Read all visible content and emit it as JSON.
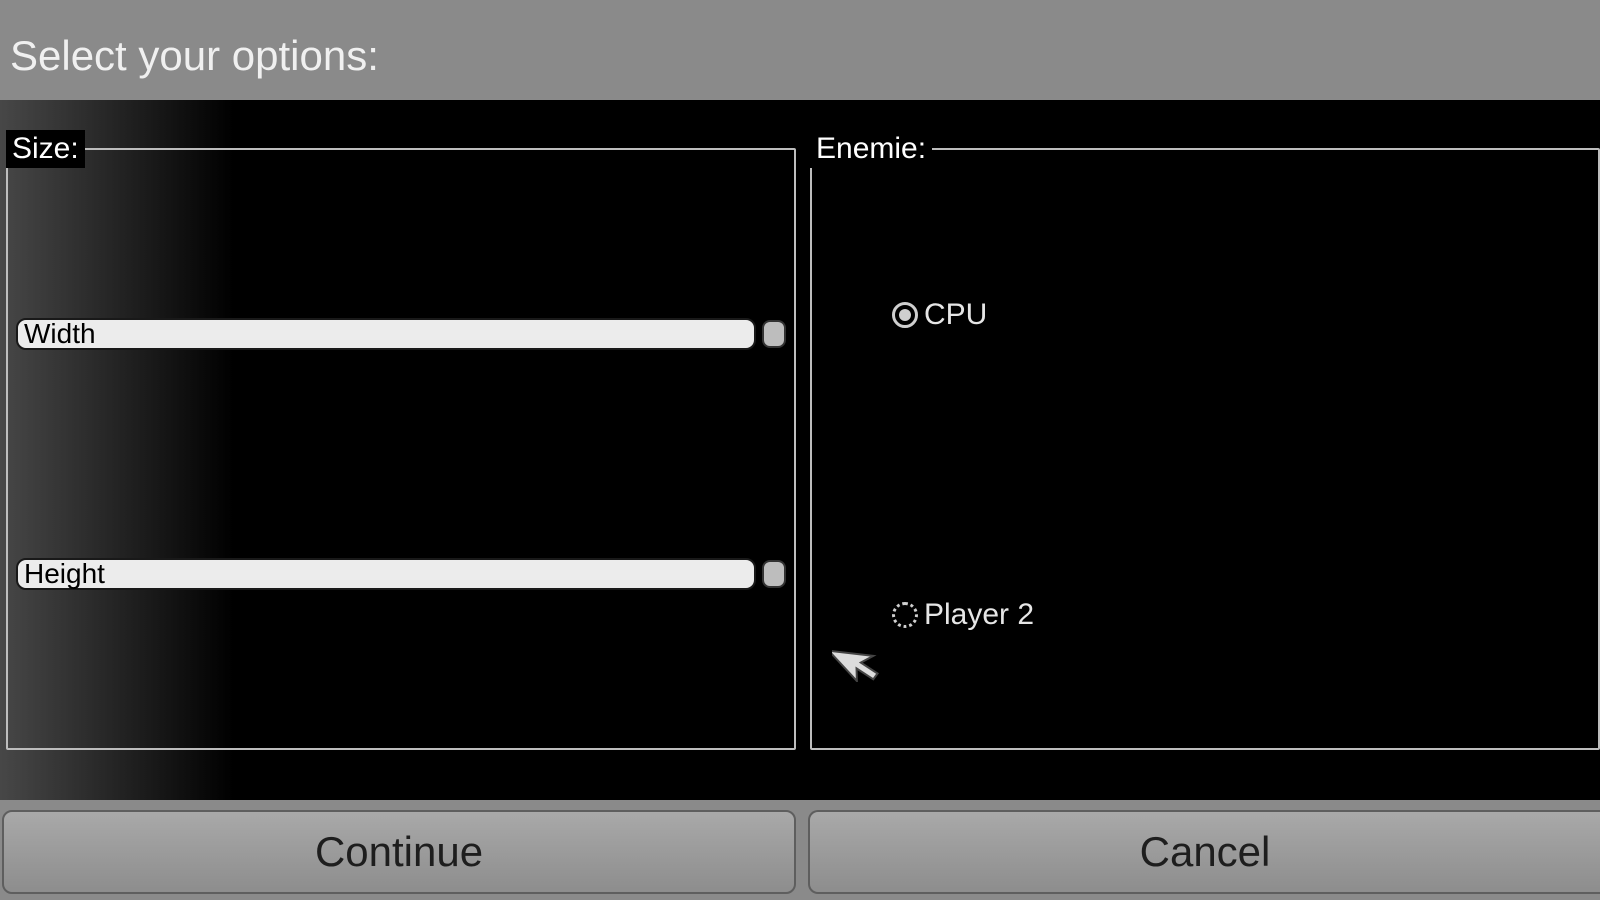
{
  "header": {
    "title": "Select your options:"
  },
  "panels": {
    "size": {
      "legend": "Size:",
      "width_label": "Width",
      "height_label": "Height"
    },
    "enemy": {
      "legend": "Enemie:",
      "options": {
        "cpu": {
          "label": "CPU",
          "selected": true
        },
        "player2": {
          "label": "Player 2",
          "selected": false
        }
      }
    }
  },
  "footer": {
    "continue_label": "Continue",
    "cancel_label": "Cancel"
  }
}
